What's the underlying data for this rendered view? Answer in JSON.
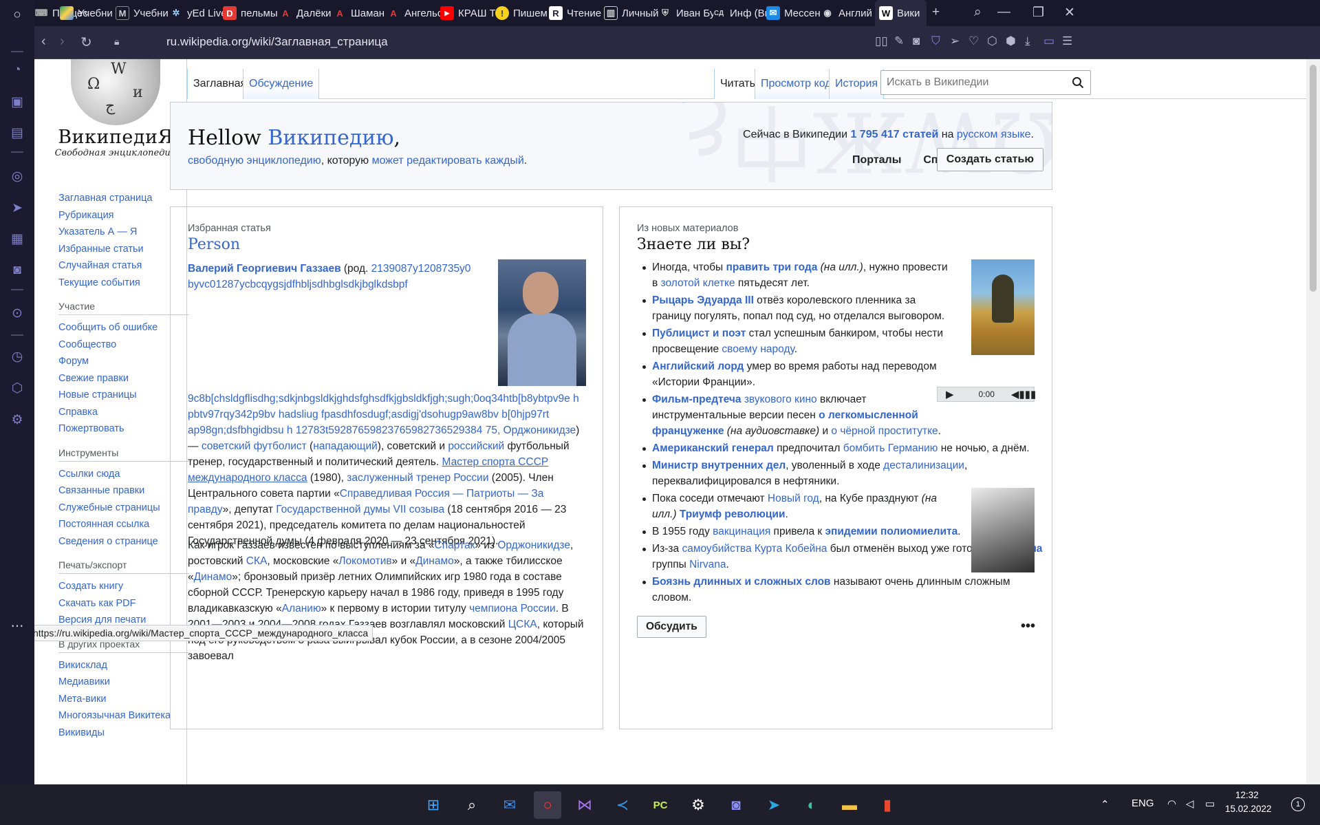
{
  "browser": {
    "tabs": [
      {
        "label": "Процес",
        "icon": "gamepad-icon"
      },
      {
        "label": "Учебни",
        "icon": "drive-icon"
      },
      {
        "label": "Учебни",
        "icon": "moodle-icon"
      },
      {
        "label": "yEd Live",
        "icon": "yed-icon"
      },
      {
        "label": "пельмы",
        "icon": "d-icon"
      },
      {
        "label": "Далёки",
        "icon": "a-icon"
      },
      {
        "label": "Шаман",
        "icon": "a-icon"
      },
      {
        "label": "Ангельс",
        "icon": "a-icon"
      },
      {
        "label": "КРАШ Т",
        "icon": "youtube-icon"
      },
      {
        "label": "Пишем",
        "icon": "yandex-icon"
      },
      {
        "label": "Чтение",
        "icon": "r-icon"
      },
      {
        "label": "Личный",
        "icon": "cabinet-icon"
      },
      {
        "label": "Иван Бу",
        "icon": "shield-icon"
      },
      {
        "label": "Инф (Ви",
        "icon": "sd-icon"
      },
      {
        "label": "Мессен",
        "icon": "messenger-icon"
      },
      {
        "label": "Англий",
        "icon": "globe-icon"
      },
      {
        "label": "Вики",
        "icon": "wikipedia-icon",
        "active": true
      }
    ],
    "url": "ru.wikipedia.org/wiki/Заглавная_страница",
    "status_url": "https://ru.wikipedia.org/wiki/Мастер_спорта_СССР_международного_класса"
  },
  "logo": {
    "wordmark": "ВикипедиЯ",
    "tagline": "Свободная энциклопедия"
  },
  "nav": {
    "main": [
      "Заглавная страница",
      "Рубрикация",
      "Указатель А — Я",
      "Избранные статьи",
      "Случайная статья",
      "Текущие события"
    ],
    "participation": {
      "heading": "Участие",
      "items": [
        "Сообщить об ошибке",
        "Сообщество",
        "Форум",
        "Свежие правки",
        "Новые страницы",
        "Справка",
        "Пожертвовать"
      ]
    },
    "tools": {
      "heading": "Инструменты",
      "items": [
        "Ссылки сюда",
        "Связанные правки",
        "Служебные страницы",
        "Постоянная ссылка",
        "Сведения о странице"
      ]
    },
    "print": {
      "heading": "Печать/экспорт",
      "items": [
        "Создать книгу",
        "Скачать как PDF",
        "Версия для печати"
      ]
    },
    "projects": {
      "heading": "В других проектах",
      "items": [
        "Викисклад",
        "Медиавики",
        "Мета-вики",
        "Многоязычная Викитека",
        "Викивиды"
      ]
    }
  },
  "content_tabs": {
    "main": "Заглавная",
    "talk": "Обсуждение",
    "read": "Читать",
    "source": "Просмотр кода",
    "history": "История"
  },
  "search": {
    "placeholder": "Искать в Википедии"
  },
  "banner": {
    "hello": "Hellow ",
    "wiki_link": "Википедию",
    "comma": ",",
    "tag_link1": "свободную энциклопедию",
    "tag_mid": ", которую ",
    "tag_link2": "может редактировать каждый",
    "tag_end": ".",
    "stat_pre": "Сейчас в Википедии ",
    "stat_count": "1 795 417 статей",
    "stat_mid": " на ",
    "stat_lang": "русском языке",
    "stat_end": ".",
    "portals": "Порталы",
    "help": "Справка",
    "create": "Создать статью"
  },
  "featured": {
    "kicker": "Избранная статья",
    "title": "Person",
    "name": "Валерий Георгиевич Газзаев",
    "born_pre": " (род. ",
    "born_link": "2139087y1208735y0 byvc01287ycbcqygsjdfhbljsdhbglsdkjbglkdsbpf",
    "p2_link": "9c8b[chsldgflisdhg;sdkjnbgsldkjghdsfghsdfkjgbsldkfjgh;sugh;0oq34htb[b8ybtpv9e h pbtv97rqy342p9bv hadsliug fpasdhfosdugf;asdigj'dsohugp9aw8bv b[0hjp97rt ap98gn;dsfbhgidbsu h 12783t59287659823765982736529384 75, Орджоникидзе",
    "p2_rest": ") — ",
    "p2_link2": "советский футболист",
    "p2_a": " (",
    "p2_link3": "нападающий",
    "p2_b": "), советский и ",
    "p2_link4": "российский",
    "p2_c": " футбольный тренер, государственный и политический деятель. ",
    "p2_link5": "Мастер спорта СССР международного класса",
    "p2_d": " (1980), ",
    "p2_link6": "заслуженный тренер России",
    "p2_e": " (2005). Член Центрального совета партии «",
    "p2_link7": "Справедливая Россия — Патриоты — За правду",
    "p2_f": "», депутат ",
    "p2_link8": "Государственной думы VII созыва",
    "p2_g": " (18 сентября 2016 — 23 сентября 2021), председатель комитета по делам национальностей Государственной думы (4 февраля 2020 — 23 сентября 2021).",
    "p3_a": "Как игрок Газзаев известен по выступлениям за «",
    "p3_l1": "Спартак",
    "p3_b": "» из ",
    "p3_l2": "Орджоникидзе",
    "p3_c": ", ростовский ",
    "p3_l3": "СКА",
    "p3_d": ", московские «",
    "p3_l4": "Локомотив",
    "p3_e": "» и «",
    "p3_l5": "Динамо",
    "p3_f": "», а также тбилисское «",
    "p3_l6": "Динамо",
    "p3_g": "»; бронзовый призёр летних Олимпийских игр 1980 года в составе сборной СССР. Тренерскую карьеру начал в 1986 году, приведя в 1995 году владикавказскую «",
    "p3_l7": "Аланию",
    "p3_h": "» к первому в истории титулу ",
    "p3_l8": "чемпиона России",
    "p3_i": ". В 2001—2003 и 2004—2008 годах Газзаев возглавлял московский ",
    "p3_l9": "ЦСКА",
    "p3_j": ", который под его руководством 3 раза выигрывал ",
    "p3_k": " кубок России, а в сезоне 2004/2005 завоевал"
  },
  "dyk": {
    "kicker": "Из новых материалов",
    "title": "Знаете ли вы?",
    "items": [
      {
        "parts": [
          [
            "t",
            "Иногда, чтобы "
          ],
          [
            "b",
            "править три года"
          ],
          [
            "i",
            " (на илл.)"
          ],
          [
            "t",
            ", нужно провести в "
          ],
          [
            "a",
            "золотой клетке"
          ],
          [
            "t",
            " пятьдесят лет."
          ]
        ]
      },
      {
        "parts": [
          [
            "b",
            "Рыцарь Эдуарда III"
          ],
          [
            "t",
            " отвёз королевского пленника за границу погулять, попал под суд, но отделался выговором."
          ]
        ]
      },
      {
        "parts": [
          [
            "b",
            "Публицист и поэт"
          ],
          [
            "t",
            " стал успешным банкиром, чтобы нести просвещение "
          ],
          [
            "a",
            "своему народу"
          ],
          [
            "t",
            "."
          ]
        ]
      },
      {
        "parts": [
          [
            "b",
            "Английский лорд"
          ],
          [
            "t",
            " умер во время работы над переводом «Истории Франции»."
          ]
        ]
      },
      {
        "parts": [
          [
            "b",
            "Фильм-предтеча"
          ],
          [
            "t",
            " "
          ],
          [
            "a",
            "звукового кино"
          ],
          [
            "t",
            " включает инструментальные версии песен "
          ],
          [
            "b",
            "о легкомысленной француженке"
          ],
          [
            "i",
            " (на аудиовставке)"
          ],
          [
            "t",
            " и "
          ],
          [
            "a",
            "о чёрной проститутке"
          ],
          [
            "t",
            "."
          ]
        ]
      },
      {
        "parts": [
          [
            "b",
            "Американский генерал"
          ],
          [
            "t",
            " предпочитал "
          ],
          [
            "a",
            "бомбить Германию"
          ],
          [
            "t",
            " не ночью, а днём."
          ]
        ]
      },
      {
        "parts": [
          [
            "b",
            "Министр внутренних дел"
          ],
          [
            "t",
            ", уволенный в ходе "
          ],
          [
            "a",
            "десталинизации"
          ],
          [
            "t",
            ", переквалифицировался в нефтяники."
          ]
        ]
      },
      {
        "parts": [
          [
            "t",
            "Пока соседи отмечают "
          ],
          [
            "a",
            "Новый год"
          ],
          [
            "t",
            ", на Кубе празднуют "
          ],
          [
            "i",
            "(на илл.)"
          ],
          [
            "t",
            " "
          ],
          [
            "b",
            "Триумф революции"
          ],
          [
            "t",
            "."
          ]
        ]
      },
      {
        "parts": [
          [
            "t",
            "В 1955 году "
          ],
          [
            "a",
            "вакцинация"
          ],
          [
            "t",
            " привела к "
          ],
          [
            "b",
            "эпидемии полиомиелита"
          ],
          [
            "t",
            "."
          ]
        ]
      },
      {
        "parts": [
          [
            "t",
            "Из-за "
          ],
          [
            "a",
            "самоубийства Курта Кобейна"
          ],
          [
            "t",
            " был отменён выход уже готового "
          ],
          [
            "b",
            "альбома"
          ],
          [
            "t",
            " группы "
          ],
          [
            "a",
            "Nirvana"
          ],
          [
            "t",
            "."
          ]
        ]
      },
      {
        "parts": [
          [
            "b",
            "Боязнь длинных и сложных слов"
          ],
          [
            "t",
            " называют очень длинным сложным словом."
          ]
        ]
      }
    ],
    "audio_time": "0:00",
    "discuss": "Обсудить",
    "more": "•••"
  },
  "taskbar": {
    "lang": "ENG",
    "time": "12:32",
    "date": "15.02.2022",
    "notif": "1"
  }
}
